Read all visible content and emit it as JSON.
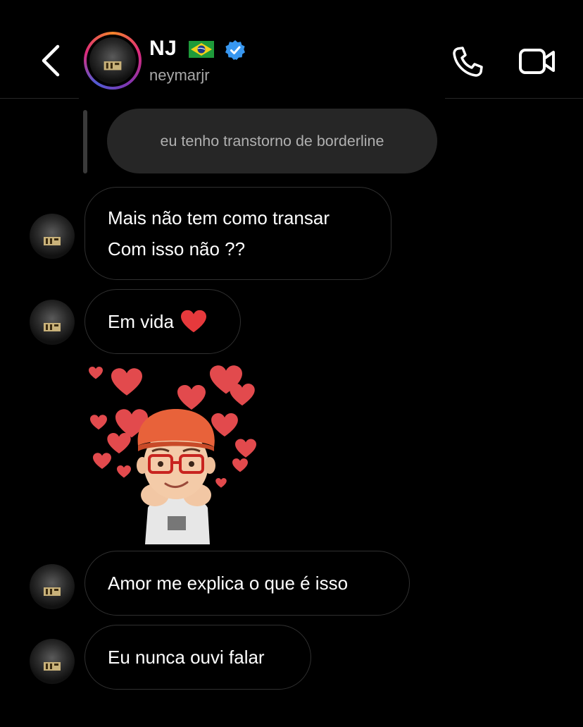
{
  "header": {
    "name": "NJ",
    "username": "neymarjr",
    "back_icon": "chevron-left-icon",
    "call_icon": "phone-icon",
    "video_icon": "video-camera-icon",
    "flag_icon": "brazil-flag-icon",
    "verified_icon": "verified-badge-icon",
    "ring_colors": [
      "#f58529",
      "#dd2a7b",
      "#8134af",
      "#515bd4"
    ],
    "verified_color": "#3897f0"
  },
  "reply": {
    "text": "eu tenho transtorno de borderline"
  },
  "messages": [
    {
      "lines": [
        "Mais não tem como transar",
        "Com isso não ??"
      ]
    },
    {
      "text": "Em vida",
      "emoji": "red-heart-icon"
    },
    {
      "sticker": "memoji-hearts-sticker"
    },
    {
      "text": "Amor me explica o que é isso"
    },
    {
      "text": "Eu nunca ouvi falar"
    }
  ],
  "colors": {
    "background": "#000000",
    "bubble_border": "#303030",
    "reply_bubble": "#262626",
    "heart": "#e6393c"
  }
}
